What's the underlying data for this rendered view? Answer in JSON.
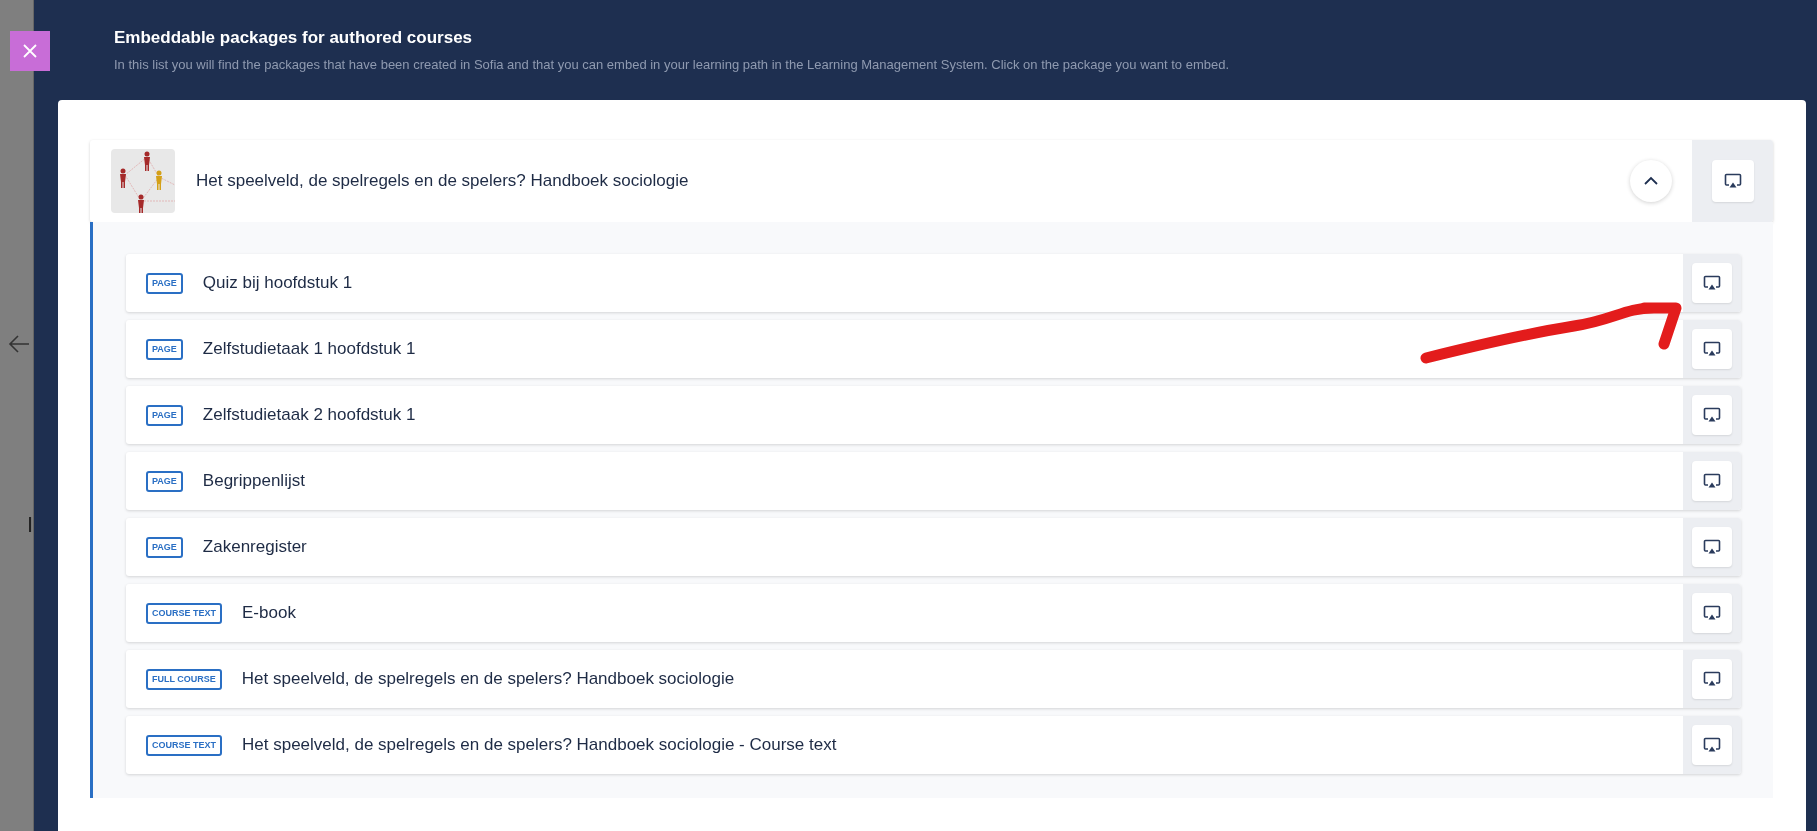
{
  "backdrop": {
    "text": "I"
  },
  "dialog": {
    "title": "Embeddable packages for authored courses",
    "description": "In this list you will find the packages that have been created in Sofia and that you can embed in your learning path in the Learning Management System. Click on the package you want to embed."
  },
  "package": {
    "title": "Het speelveld, de spelregels en de spelers? Handboek sociologie",
    "expanded": true,
    "items": [
      {
        "tag": "PAGE",
        "title": "Quiz bij hoofdstuk 1"
      },
      {
        "tag": "PAGE",
        "title": "Zelfstudietaak 1 hoofdstuk 1"
      },
      {
        "tag": "PAGE",
        "title": "Zelfstudietaak 2 hoofdstuk 1"
      },
      {
        "tag": "PAGE",
        "title": "Begrippenlijst"
      },
      {
        "tag": "PAGE",
        "title": "Zakenregister"
      },
      {
        "tag": "COURSE TEXT",
        "title": "E-book"
      },
      {
        "tag": "FULL COURSE",
        "title": "Het speelveld, de spelregels en de spelers? Handboek sociologie"
      },
      {
        "tag": "COURSE TEXT",
        "title": "Het speelveld, de spelregels en de spelers? Handboek sociologie - Course text"
      }
    ]
  }
}
